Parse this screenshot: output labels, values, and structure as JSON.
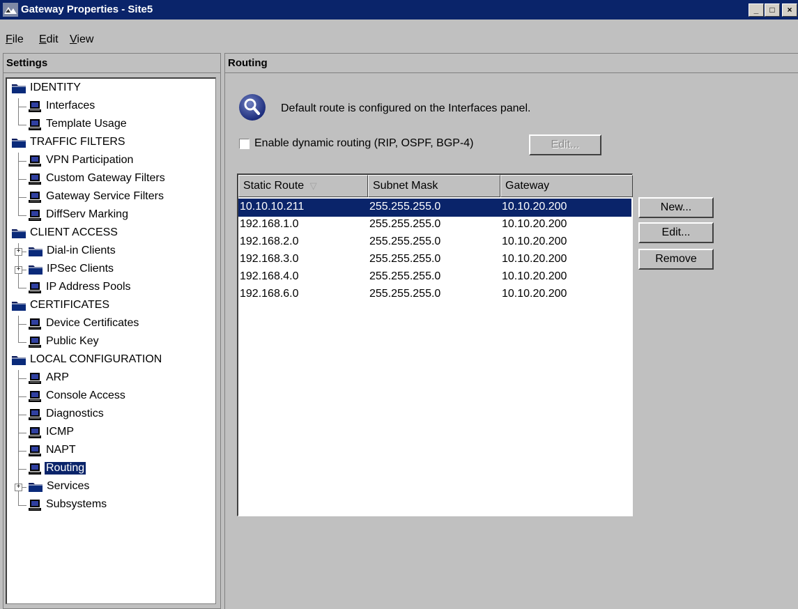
{
  "window": {
    "title": "Gateway Properties - Site5",
    "controls": {
      "minimize": "_",
      "maximize": "□",
      "close": "×"
    }
  },
  "menu": {
    "file": "File",
    "edit": "Edit",
    "view": "View"
  },
  "settings_panel": {
    "header": "Settings",
    "tree": [
      {
        "label": "IDENTITY",
        "type": "folder",
        "level": 0
      },
      {
        "label": "Interfaces",
        "type": "item",
        "level": 1
      },
      {
        "label": "Template Usage",
        "type": "item",
        "level": 1
      },
      {
        "label": "TRAFFIC FILTERS",
        "type": "folder",
        "level": 0
      },
      {
        "label": "VPN Participation",
        "type": "item",
        "level": 1
      },
      {
        "label": "Custom Gateway Filters",
        "type": "item",
        "level": 1
      },
      {
        "label": "Gateway Service Filters",
        "type": "item",
        "level": 1
      },
      {
        "label": "DiffServ Marking",
        "type": "item",
        "level": 1
      },
      {
        "label": "CLIENT ACCESS",
        "type": "folder",
        "level": 0
      },
      {
        "label": "Dial-in Clients",
        "type": "folder",
        "level": 1,
        "expandable": true
      },
      {
        "label": "IPSec Clients",
        "type": "folder",
        "level": 1,
        "expandable": true
      },
      {
        "label": "IP Address Pools",
        "type": "item",
        "level": 1
      },
      {
        "label": "CERTIFICATES",
        "type": "folder",
        "level": 0
      },
      {
        "label": "Device Certificates",
        "type": "item",
        "level": 1
      },
      {
        "label": "Public Key",
        "type": "item",
        "level": 1
      },
      {
        "label": "LOCAL CONFIGURATION",
        "type": "folder",
        "level": 0
      },
      {
        "label": "ARP",
        "type": "item",
        "level": 1
      },
      {
        "label": "Console Access",
        "type": "item",
        "level": 1
      },
      {
        "label": "Diagnostics",
        "type": "item",
        "level": 1
      },
      {
        "label": "ICMP",
        "type": "item",
        "level": 1
      },
      {
        "label": "NAPT",
        "type": "item",
        "level": 1
      },
      {
        "label": "Routing",
        "type": "item",
        "level": 1,
        "selected": true
      },
      {
        "label": "Services",
        "type": "folder",
        "level": 1,
        "expandable": true
      },
      {
        "label": "Subsystems",
        "type": "item",
        "level": 1
      }
    ]
  },
  "routing_panel": {
    "header": "Routing",
    "info_text": "Default route is configured on the Interfaces panel.",
    "dynamic_routing_label": "Enable dynamic routing (RIP, OSPF, BGP-4)",
    "dynamic_routing_checked": false,
    "edit_dynamic_label": "Edit...",
    "table": {
      "columns": [
        "Static Route",
        "Subnet Mask",
        "Gateway"
      ],
      "sort_indicator": "▽",
      "rows": [
        {
          "route": "10.10.10.211",
          "mask": "255.255.255.0",
          "gateway": "10.10.20.200",
          "selected": true
        },
        {
          "route": "192.168.1.0",
          "mask": "255.255.255.0",
          "gateway": "10.10.20.200"
        },
        {
          "route": "192.168.2.0",
          "mask": "255.255.255.0",
          "gateway": "10.10.20.200"
        },
        {
          "route": "192.168.3.0",
          "mask": "255.255.255.0",
          "gateway": "10.10.20.200"
        },
        {
          "route": "192.168.4.0",
          "mask": "255.255.255.0",
          "gateway": "10.10.20.200"
        },
        {
          "route": "192.168.6.0",
          "mask": "255.255.255.0",
          "gateway": "10.10.20.200"
        }
      ]
    },
    "buttons": {
      "new": "New...",
      "edit": "Edit...",
      "remove": "Remove"
    }
  },
  "colors": {
    "titlebar": "#0a246a",
    "selection": "#0a246a",
    "background": "#c0c0c0"
  }
}
